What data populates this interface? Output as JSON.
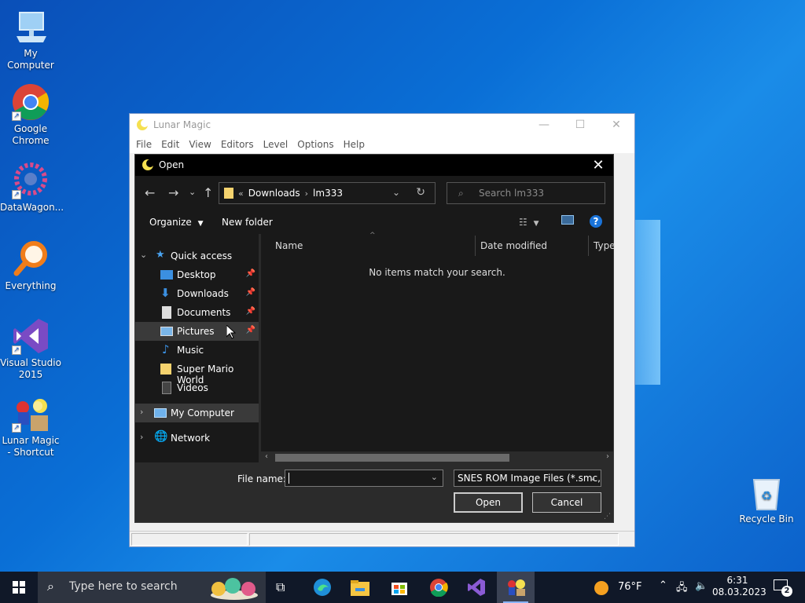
{
  "desktop": {
    "icons": [
      {
        "label": "My Computer",
        "icon": "computer-icon"
      },
      {
        "label": "Google Chrome",
        "icon": "chrome-icon"
      },
      {
        "label": "DataWagon...",
        "icon": "datawagon-icon"
      },
      {
        "label": "Everything",
        "icon": "everything-search-icon"
      },
      {
        "label": "Visual Studio 2015",
        "icon": "visual-studio-icon"
      },
      {
        "label": "Lunar Magic - Shortcut",
        "icon": "lunar-magic-icon"
      },
      {
        "label": "Recycle Bin",
        "icon": "recycle-bin-icon"
      }
    ]
  },
  "lunar_magic": {
    "title": "Lunar Magic",
    "menu": [
      "File",
      "Edit",
      "View",
      "Editors",
      "Level",
      "Options",
      "Help"
    ]
  },
  "open_dialog": {
    "title": "Open",
    "breadcrumb": {
      "overflow": "«",
      "items": [
        "Downloads",
        "lm333"
      ]
    },
    "search_placeholder": "Search lm333",
    "toolbar": {
      "organize": "Organize",
      "new_folder": "New folder",
      "help": "?"
    },
    "nav": {
      "quick_access": "Quick access",
      "items": [
        "Desktop",
        "Downloads",
        "Documents",
        "Pictures",
        "Music",
        "Super Mario World",
        "Videos"
      ],
      "my_computer": "My Computer",
      "network": "Network"
    },
    "columns": [
      "Name",
      "Date modified",
      "Type"
    ],
    "empty_message": "No items match your search.",
    "file_name_label": "File name:",
    "file_name_value": "",
    "file_type": "SNES ROM Image Files (*.smc,*",
    "open_label": "Open",
    "cancel_label": "Cancel"
  },
  "taskbar": {
    "search_placeholder": "Type here to search",
    "weather": "76°F",
    "time": "6:31",
    "date": "08.03.2023",
    "notifications": "2"
  },
  "colors": {
    "desktop_blue": "#0a6fd6",
    "dialog_dark": "#191919",
    "taskbar": "#101828"
  }
}
